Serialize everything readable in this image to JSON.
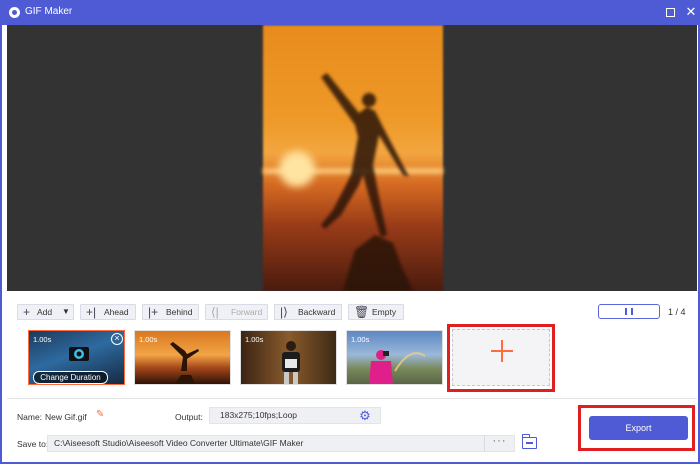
{
  "window": {
    "title": "GIF Maker"
  },
  "toolbar": {
    "add": "Add",
    "ahead": "Ahead",
    "behind": "Behind",
    "forward": "Forward",
    "backward": "Backward",
    "empty": "Empty"
  },
  "playback": {
    "counter": "1 / 4"
  },
  "clips": [
    {
      "duration": "1.00s",
      "action": "Change Duration"
    },
    {
      "duration": "1.00s"
    },
    {
      "duration": "1.00s"
    },
    {
      "duration": "1.00s"
    }
  ],
  "settings": {
    "name_label": "Name:",
    "name_value": "New Gif.gif",
    "output_label": "Output:",
    "output_value": "183x275;10fps;Loop",
    "save_label": "Save to:",
    "save_path": "C:\\Aiseesoft Studio\\Aiseesoft Video Converter Ultimate\\GIF Maker",
    "browse": "···"
  },
  "export": {
    "label": "Export"
  },
  "colors": {
    "accent": "#4f5bd5",
    "highlight": "#ff6b3d",
    "annotation": "#e02020"
  }
}
